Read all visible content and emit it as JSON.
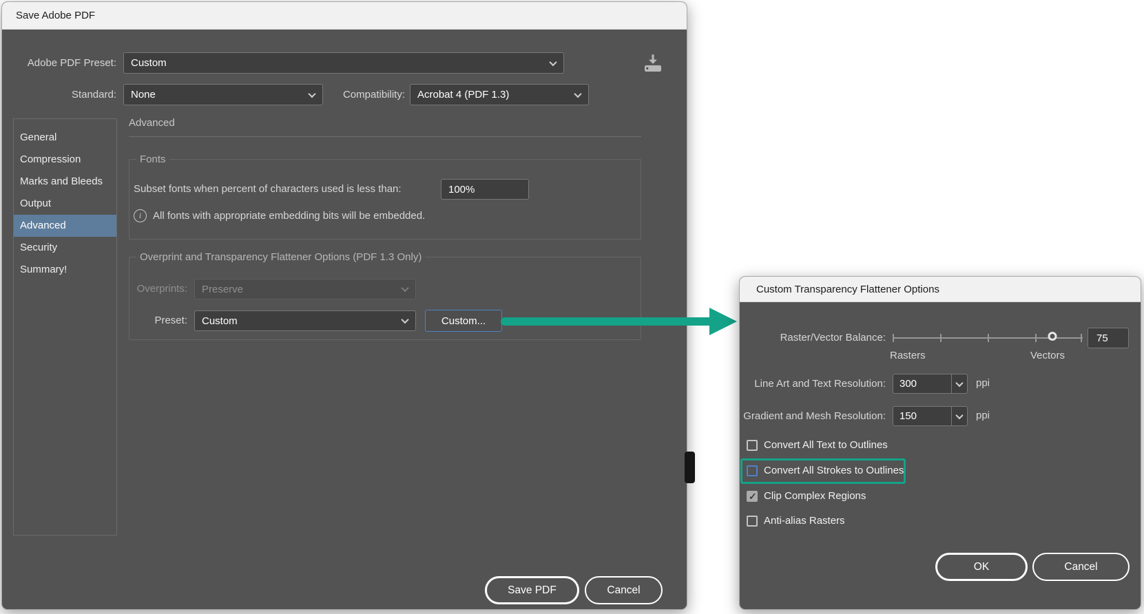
{
  "colors": {
    "accent_teal": "#14A389",
    "focus_blue": "#4E82C6",
    "sidebar_selected": "#5E7D9C"
  },
  "icons": {
    "chevron_down": "css-chevron",
    "info": "i",
    "save_preset": "download-to-tray"
  },
  "save_pdf_dialog": {
    "title": "Save Adobe PDF",
    "preset": {
      "label": "Adobe PDF Preset:",
      "value": "Custom"
    },
    "standard": {
      "label": "Standard:",
      "value": "None"
    },
    "compatibility": {
      "label": "Compatibility:",
      "value": "Acrobat 4 (PDF 1.3)"
    },
    "sidebar": {
      "items": [
        {
          "label": "General",
          "selected": false
        },
        {
          "label": "Compression",
          "selected": false
        },
        {
          "label": "Marks and Bleeds",
          "selected": false
        },
        {
          "label": "Output",
          "selected": false
        },
        {
          "label": "Advanced",
          "selected": true
        },
        {
          "label": "Security",
          "selected": false
        },
        {
          "label": "Summary!",
          "selected": false
        }
      ]
    },
    "panel_heading": "Advanced",
    "fonts_group": {
      "legend": "Fonts",
      "subset_label": "Subset fonts when percent of characters used is less than:",
      "subset_value": "100%",
      "info_text": "All fonts with appropriate embedding bits will be embedded."
    },
    "flattener_group": {
      "legend": "Overprint and Transparency Flattener Options (PDF 1.3 Only)",
      "overprints_label": "Overprints:",
      "overprints_value": "Preserve",
      "overprints_disabled": true,
      "preset_label": "Preset:",
      "preset_value": "Custom",
      "custom_button_label": "Custom..."
    },
    "footer_buttons": {
      "save": "Save PDF",
      "cancel": "Cancel"
    }
  },
  "flattener_dialog": {
    "title": "Custom Transparency Flattener Options",
    "balance": {
      "label": "Raster/Vector Balance:",
      "value": "75",
      "min_label": "Rasters",
      "max_label": "Vectors",
      "slider_percent": 84
    },
    "line_art": {
      "label": "Line Art and Text Resolution:",
      "value": "300",
      "unit": "ppi"
    },
    "gradient": {
      "label": "Gradient and Mesh Resolution:",
      "value": "150",
      "unit": "ppi"
    },
    "checkboxes": [
      {
        "label": "Convert All Text to Outlines",
        "checked": false,
        "focused": false,
        "highlighted": false
      },
      {
        "label": "Convert All Strokes to Outlines",
        "checked": false,
        "focused": true,
        "highlighted": true
      },
      {
        "label": "Clip Complex Regions",
        "checked": true,
        "focused": false,
        "highlighted": false
      },
      {
        "label": "Anti-alias Rasters",
        "checked": false,
        "focused": false,
        "highlighted": false
      }
    ],
    "buttons": {
      "ok": "OK",
      "cancel": "Cancel"
    }
  }
}
